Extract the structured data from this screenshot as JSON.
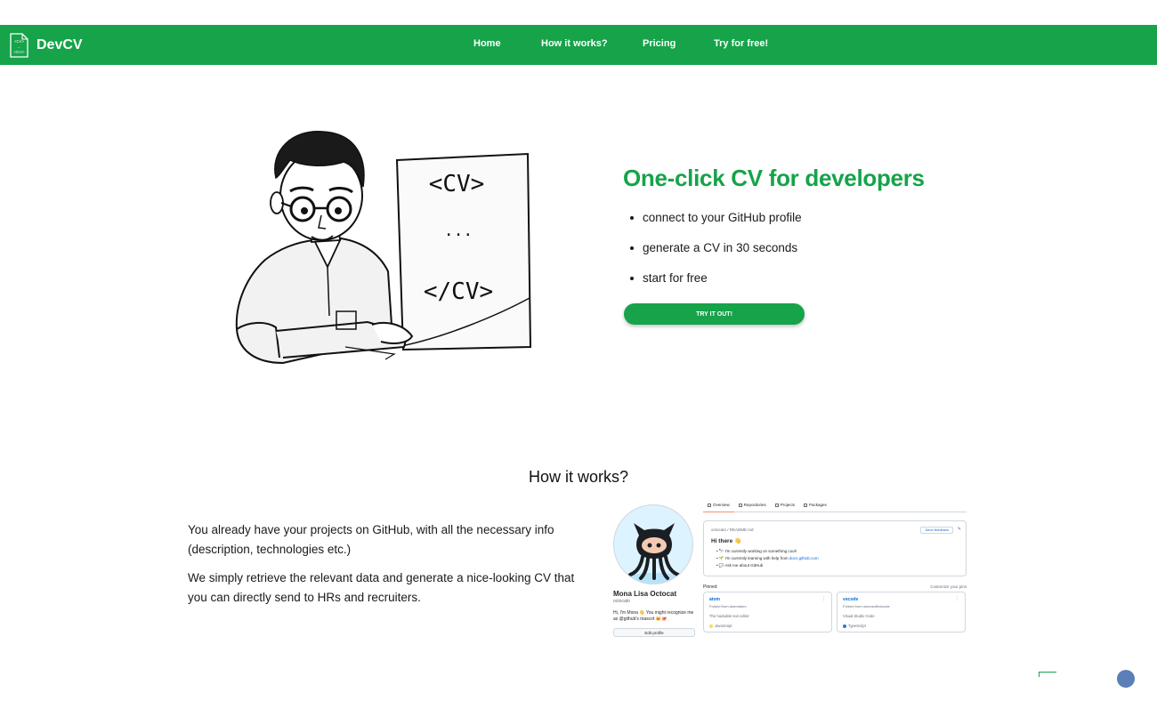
{
  "brand": {
    "name": "DevCV",
    "logo_text": [
      "<CV>",
      "...",
      "</CV>"
    ]
  },
  "nav": {
    "items": [
      {
        "label": "Home"
      },
      {
        "label": "How it works?"
      },
      {
        "label": "Pricing"
      },
      {
        "label": "Try for free!"
      }
    ]
  },
  "hero": {
    "sign_top": "<CV>",
    "sign_mid": "...",
    "sign_bottom": "</CV>",
    "title": "One-click CV for developers",
    "bullets": [
      "connect to your GitHub profile",
      "generate a CV in 30 seconds",
      "start for free"
    ],
    "cta_label": "TRY IT OUT!"
  },
  "how": {
    "title": "How it works?",
    "paragraphs": [
      "You already have your projects on GitHub, with all the necessary info (description, technologies etc.)",
      "We simply retrieve the relevant data and generate a nice-looking CV that you can directly send to HRs and recruiters."
    ]
  },
  "github_preview": {
    "name": "Mona Lisa Octocat",
    "login": "octocato",
    "bio": "Hi, I'm Mona 👋 You might recognize me as @github's mascot 🐱🐙",
    "edit_label": "Edit profile",
    "tabs": [
      "Overview",
      "Repositories",
      "Projects",
      "Packages"
    ],
    "readme_path": "octocato / README.md",
    "feedback_label": "Send feedback",
    "greeting": "Hi there 👋",
    "readme_items": [
      {
        "text": "🔭 I'm currently working on something cool!",
        "link": ""
      },
      {
        "text": "🌱 I'm currently learning with help from ",
        "link": "docs.github.com"
      },
      {
        "text": "💬 Ask me about GitHub",
        "link": ""
      }
    ],
    "pinned_label": "Pinned",
    "customize_label": "Customize your pins",
    "cards": [
      {
        "name": "atom",
        "fork": "Forked from atom/atom",
        "desc": "The hackable text editor",
        "lang": "JavaScript",
        "lang_color": "#f1e05a"
      },
      {
        "name": "vscode",
        "fork": "Forked from microsoft/vscode",
        "desc": "Visual Studio Code",
        "lang": "TypeScript",
        "lang_color": "#3178c6"
      }
    ],
    "icons": [
      "book-icon",
      "repo-icon",
      "project-icon",
      "package-icon",
      "pencil-icon",
      "kebab-icon"
    ]
  },
  "colors": {
    "brand_green": "#16a34a",
    "link_blue": "#0969da"
  }
}
